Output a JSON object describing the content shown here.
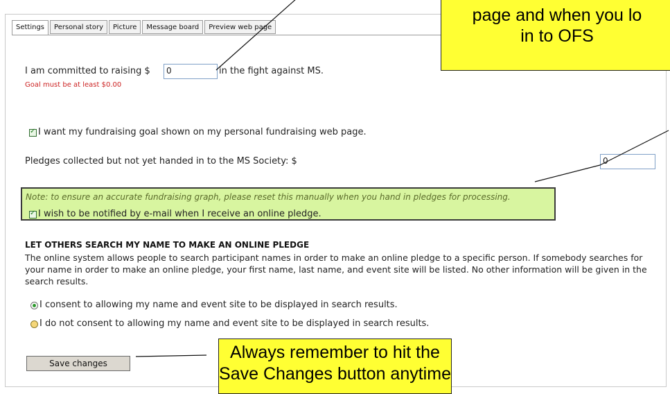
{
  "tabs": [
    {
      "label": "Settings",
      "active": true
    },
    {
      "label": "Personal story",
      "active": false
    },
    {
      "label": "Picture",
      "active": false
    },
    {
      "label": "Message board",
      "active": false
    },
    {
      "label": "Preview web page",
      "active": false
    }
  ],
  "goal": {
    "prefix": "I am committed to raising $",
    "value": "0",
    "suffix": "in the fight against MS.",
    "error": "Goal must be at least $0.00"
  },
  "show_goal_checkbox": {
    "checked": true,
    "label": "I want my fundraising goal shown on my personal fundraising web page."
  },
  "pledges": {
    "label": "Pledges collected but not yet handed in to the MS Society: $",
    "value": "0",
    "note": "Note: to ensure an accurate fundraising graph, please reset this manually when you hand in pledges for processing."
  },
  "notify_checkbox": {
    "checked": true,
    "label": "I wish to be notified by e-mail when I receive an online pledge."
  },
  "search_section": {
    "heading": "LET OTHERS SEARCH MY NAME TO MAKE AN ONLINE PLEDGE",
    "description": "The online system allows people to search participant names in order to make an online pledge to a specific person. If somebody searches for your name in order to make an online pledge, your first name, last name, and event site will be listed. No other information will be given in the search results."
  },
  "consent_options": [
    {
      "label": "I consent to allowing my name and event site to be displayed in search results.",
      "selected": true
    },
    {
      "label": "I do not consent to allowing my name and event site to be displayed in search results.",
      "selected": false
    }
  ],
  "save_button": "Save changes",
  "callouts": {
    "top_line1": "page and when you lo",
    "top_line2": "in to OFS",
    "bottom_line1": "Always remember to hit the",
    "bottom_line2": "Save Changes button anytime"
  }
}
